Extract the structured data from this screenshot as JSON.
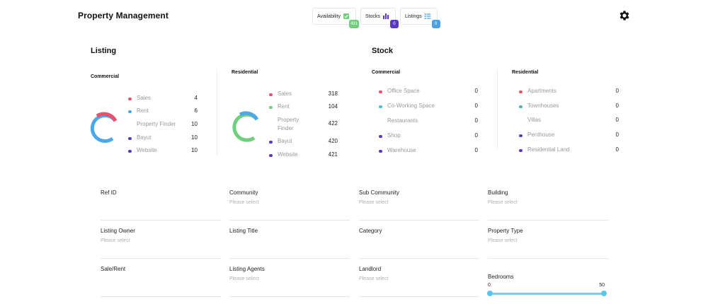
{
  "app": {
    "title": "Property Management"
  },
  "header": {
    "pills": [
      {
        "label": "Availability",
        "count": "431",
        "icon": "check-square-icon",
        "color": "#6fcf7d"
      },
      {
        "label": "Stocks",
        "count": "0",
        "icon": "bar-chart-icon",
        "color": "#5a37c4"
      },
      {
        "label": "Listings",
        "count": "0",
        "icon": "list-icon",
        "color": "#4aa0e0"
      }
    ],
    "settings_icon": "gear-icon"
  },
  "listing": {
    "title": "Listing",
    "commercial": {
      "title": "Commercial",
      "items": [
        {
          "label": "Sales",
          "value": "4",
          "color": "#e8506b"
        },
        {
          "label": "Rent",
          "value": "6",
          "color": "#4aa8e8"
        },
        {
          "label": "Property Finder",
          "value": "10",
          "color": ""
        },
        {
          "label": "Bayut",
          "value": "10",
          "color": "#5a37c4"
        },
        {
          "label": "Website",
          "value": "10",
          "color": "#5a37c4"
        }
      ]
    },
    "residential": {
      "title": "Residential",
      "items": [
        {
          "label": "Sales",
          "value": "318",
          "color": "#e8506b"
        },
        {
          "label": "Rent",
          "value": "104",
          "color": "#6fcf7d"
        },
        {
          "label": "Property Finder",
          "value": "422",
          "color": ""
        },
        {
          "label": "Bayut",
          "value": "420",
          "color": "#5a37c4"
        },
        {
          "label": "Website",
          "value": "421",
          "color": "#5a37c4"
        }
      ]
    }
  },
  "stock": {
    "title": "Stock",
    "commercial": {
      "title": "Commercial",
      "items": [
        {
          "label": "Office Space",
          "value": "0",
          "color": "#e8506b"
        },
        {
          "label": "Co-Working Space",
          "value": "0",
          "color": "#4ab8d8"
        },
        {
          "label": "Restaurants",
          "value": "0",
          "color": ""
        },
        {
          "label": "Shop",
          "value": "0",
          "color": "#5a37c4"
        },
        {
          "label": "Warehouse",
          "value": "0",
          "color": "#5a37c4"
        }
      ]
    },
    "residential": {
      "title": "Residential",
      "items": [
        {
          "label": "Apartments",
          "value": "0",
          "color": "#e8506b"
        },
        {
          "label": "Townhouses",
          "value": "0",
          "color": "#4ab8b0"
        },
        {
          "label": "Villas",
          "value": "0",
          "color": ""
        },
        {
          "label": "Penthouse",
          "value": "0",
          "color": "#5a37c4"
        },
        {
          "label": "Residential Land",
          "value": "0",
          "color": "#5a37c4"
        }
      ]
    }
  },
  "filters": [
    {
      "label": "Ref ID",
      "placeholder": ""
    },
    {
      "label": "Community",
      "placeholder": "Please select"
    },
    {
      "label": "Sub Community",
      "placeholder": "Please select"
    },
    {
      "label": "Building",
      "placeholder": "Please select"
    },
    {
      "label": "Listing Owner",
      "placeholder": "Please select"
    },
    {
      "label": "Listing Title",
      "placeholder": ""
    },
    {
      "label": "Category",
      "placeholder": ""
    },
    {
      "label": "Property Type",
      "placeholder": "Please select"
    },
    {
      "label": "Sale/Rent",
      "placeholder": ""
    },
    {
      "label": "Listing Agents",
      "placeholder": "Please select"
    },
    {
      "label": "Landlord",
      "placeholder": "Please select"
    }
  ],
  "bedrooms": {
    "label": "Bedrooms",
    "min": "0",
    "max": "50",
    "low": 0,
    "high": 50,
    "range_min": 0,
    "range_max": 50
  }
}
